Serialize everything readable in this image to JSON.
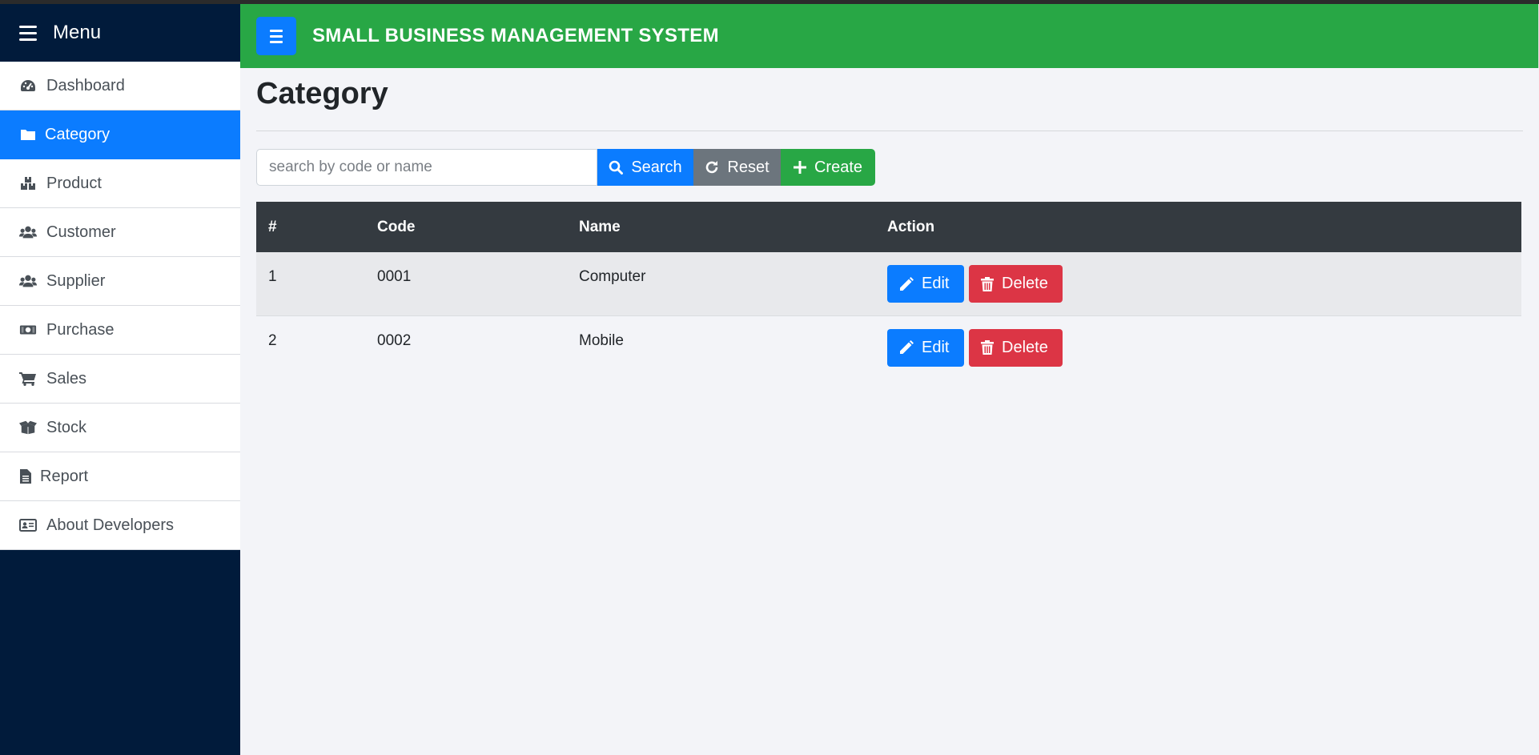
{
  "sidebar": {
    "title": "Menu",
    "items": [
      {
        "label": "Dashboard",
        "icon": "gauge-icon",
        "active": false
      },
      {
        "label": "Category",
        "icon": "folder-icon",
        "active": true
      },
      {
        "label": "Product",
        "icon": "boxes-icon",
        "active": false
      },
      {
        "label": "Customer",
        "icon": "users-icon",
        "active": false
      },
      {
        "label": "Supplier",
        "icon": "users-icon",
        "active": false
      },
      {
        "label": "Purchase",
        "icon": "money-bill-icon",
        "active": false
      },
      {
        "label": "Sales",
        "icon": "shopping-cart-icon",
        "active": false
      },
      {
        "label": "Stock",
        "icon": "box-open-icon",
        "active": false
      },
      {
        "label": "Report",
        "icon": "file-icon",
        "active": false
      },
      {
        "label": "About Developers",
        "icon": "id-card-icon",
        "active": false
      }
    ]
  },
  "header": {
    "brand": "SMALL BUSINESS MANAGEMENT SYSTEM"
  },
  "page": {
    "title": "Category"
  },
  "search": {
    "placeholder": "search by code or name",
    "value": "",
    "search_label": "Search",
    "reset_label": "Reset",
    "create_label": "Create"
  },
  "table": {
    "columns": [
      "#",
      "Code",
      "Name",
      "Action"
    ],
    "rows": [
      {
        "num": "1",
        "code": "0001",
        "name": "Computer",
        "edit_label": "Edit",
        "delete_label": "Delete"
      },
      {
        "num": "2",
        "code": "0002",
        "name": "Mobile",
        "edit_label": "Edit",
        "delete_label": "Delete"
      }
    ]
  },
  "colors": {
    "sidebar_bg": "#011b3b",
    "header_bg": "#28a745",
    "primary": "#0b7cff",
    "danger": "#dc3545",
    "secondary": "#6c757d",
    "table_head": "#343a40"
  }
}
